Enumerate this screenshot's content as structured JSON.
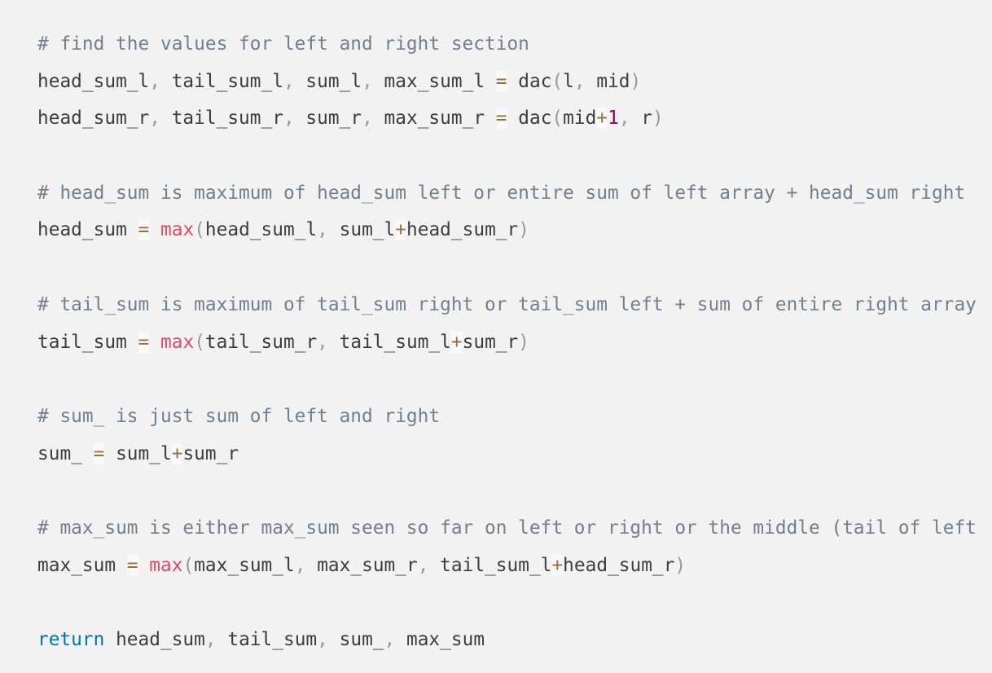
{
  "colors": {
    "background": "#f2f2f2",
    "text": "#3d3d3d",
    "comment": "#708090",
    "operator": "#9a6e3a",
    "number": "#990055",
    "builtin": "#dd4a68",
    "keyword": "#0077aa"
  },
  "lines": [
    [
      {
        "t": "comment",
        "v": "# find the values for left and right section"
      }
    ],
    [
      {
        "t": "text",
        "v": "head_sum_l"
      },
      {
        "t": "punct",
        "v": ","
      },
      {
        "t": "text",
        "v": " tail_sum_l"
      },
      {
        "t": "punct",
        "v": ","
      },
      {
        "t": "text",
        "v": " sum_l"
      },
      {
        "t": "punct",
        "v": ","
      },
      {
        "t": "text",
        "v": " max_sum_l "
      },
      {
        "t": "op",
        "v": "="
      },
      {
        "t": "text",
        "v": " dac"
      },
      {
        "t": "punct",
        "v": "("
      },
      {
        "t": "text",
        "v": "l"
      },
      {
        "t": "punct",
        "v": ","
      },
      {
        "t": "text",
        "v": " mid"
      },
      {
        "t": "punct",
        "v": ")"
      }
    ],
    [
      {
        "t": "text",
        "v": "head_sum_r"
      },
      {
        "t": "punct",
        "v": ","
      },
      {
        "t": "text",
        "v": " tail_sum_r"
      },
      {
        "t": "punct",
        "v": ","
      },
      {
        "t": "text",
        "v": " sum_r"
      },
      {
        "t": "punct",
        "v": ","
      },
      {
        "t": "text",
        "v": " max_sum_r "
      },
      {
        "t": "op",
        "v": "="
      },
      {
        "t": "text",
        "v": " dac"
      },
      {
        "t": "punct",
        "v": "("
      },
      {
        "t": "text",
        "v": "mid"
      },
      {
        "t": "op",
        "v": "+"
      },
      {
        "t": "num",
        "v": "1"
      },
      {
        "t": "punct",
        "v": ","
      },
      {
        "t": "text",
        "v": " r"
      },
      {
        "t": "punct",
        "v": ")"
      }
    ],
    [],
    [
      {
        "t": "comment",
        "v": "# head_sum is maximum of head_sum left or entire sum of left array + head_sum right"
      }
    ],
    [
      {
        "t": "text",
        "v": "head_sum "
      },
      {
        "t": "op",
        "v": "="
      },
      {
        "t": "text",
        "v": " "
      },
      {
        "t": "builtin",
        "v": "max"
      },
      {
        "t": "punct",
        "v": "("
      },
      {
        "t": "text",
        "v": "head_sum_l"
      },
      {
        "t": "punct",
        "v": ","
      },
      {
        "t": "text",
        "v": " sum_l"
      },
      {
        "t": "op",
        "v": "+"
      },
      {
        "t": "text",
        "v": "head_sum_r"
      },
      {
        "t": "punct",
        "v": ")"
      }
    ],
    [],
    [
      {
        "t": "comment",
        "v": "# tail_sum is maximum of tail_sum right or tail_sum left + sum of entire right array"
      }
    ],
    [
      {
        "t": "text",
        "v": "tail_sum "
      },
      {
        "t": "op",
        "v": "="
      },
      {
        "t": "text",
        "v": " "
      },
      {
        "t": "builtin",
        "v": "max"
      },
      {
        "t": "punct",
        "v": "("
      },
      {
        "t": "text",
        "v": "tail_sum_r"
      },
      {
        "t": "punct",
        "v": ","
      },
      {
        "t": "text",
        "v": " tail_sum_l"
      },
      {
        "t": "op",
        "v": "+"
      },
      {
        "t": "text",
        "v": "sum_r"
      },
      {
        "t": "punct",
        "v": ")"
      }
    ],
    [],
    [
      {
        "t": "comment",
        "v": "# sum_ is just sum of left and right"
      }
    ],
    [
      {
        "t": "text",
        "v": "sum_ "
      },
      {
        "t": "op",
        "v": "="
      },
      {
        "t": "text",
        "v": " sum_l"
      },
      {
        "t": "op",
        "v": "+"
      },
      {
        "t": "text",
        "v": "sum_r"
      }
    ],
    [],
    [
      {
        "t": "comment",
        "v": "# max_sum is either max_sum seen so far on left or right or the middle (tail of left"
      }
    ],
    [
      {
        "t": "text",
        "v": "max_sum "
      },
      {
        "t": "op",
        "v": "="
      },
      {
        "t": "text",
        "v": " "
      },
      {
        "t": "builtin",
        "v": "max"
      },
      {
        "t": "punct",
        "v": "("
      },
      {
        "t": "text",
        "v": "max_sum_l"
      },
      {
        "t": "punct",
        "v": ","
      },
      {
        "t": "text",
        "v": " max_sum_r"
      },
      {
        "t": "punct",
        "v": ","
      },
      {
        "t": "text",
        "v": " tail_sum_l"
      },
      {
        "t": "op",
        "v": "+"
      },
      {
        "t": "text",
        "v": "head_sum_r"
      },
      {
        "t": "punct",
        "v": ")"
      }
    ],
    [],
    [
      {
        "t": "keyword",
        "v": "return"
      },
      {
        "t": "text",
        "v": " head_sum"
      },
      {
        "t": "punct",
        "v": ","
      },
      {
        "t": "text",
        "v": " tail_sum"
      },
      {
        "t": "punct",
        "v": ","
      },
      {
        "t": "text",
        "v": " sum_"
      },
      {
        "t": "punct",
        "v": ","
      },
      {
        "t": "text",
        "v": " max_sum"
      }
    ]
  ]
}
